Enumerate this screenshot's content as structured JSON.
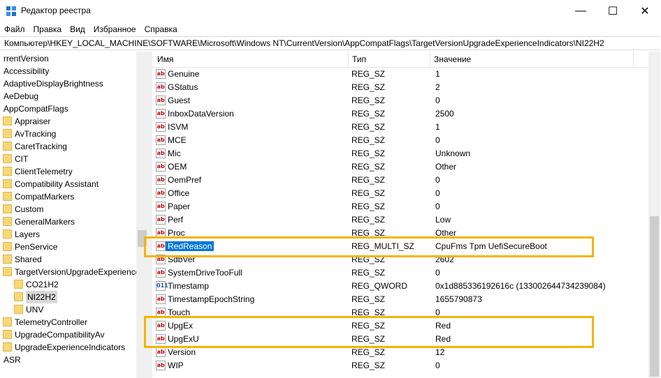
{
  "window": {
    "title": "Редактор реестра",
    "minimize_glyph": "—",
    "maximize_glyph": "☐",
    "close_glyph": "✕"
  },
  "menu": [
    "Файл",
    "Правка",
    "Вид",
    "Избранное",
    "Справка"
  ],
  "address": "Компьютер\\HKEY_LOCAL_MACHINE\\SOFTWARE\\Microsoft\\Windows NT\\CurrentVersion\\AppCompatFlags\\TargetVersionUpgradeExperienceIndicators\\NI22H2",
  "tree": [
    {
      "label": "rrentVersion",
      "folder": false,
      "level": 0
    },
    {
      "label": "Accessibility",
      "folder": false,
      "level": 0
    },
    {
      "label": "AdaptiveDisplayBrightness",
      "folder": false,
      "level": 0
    },
    {
      "label": "AeDebug",
      "folder": false,
      "level": 0
    },
    {
      "label": "AppCompatFlags",
      "folder": false,
      "level": 0
    },
    {
      "label": "Appraiser",
      "folder": true,
      "level": 1
    },
    {
      "label": "AvTracking",
      "folder": true,
      "level": 1
    },
    {
      "label": "CaretTracking",
      "folder": true,
      "level": 1
    },
    {
      "label": "CIT",
      "folder": true,
      "level": 1
    },
    {
      "label": "ClientTelemetry",
      "folder": true,
      "level": 1
    },
    {
      "label": "Compatibility Assistant",
      "folder": true,
      "level": 1
    },
    {
      "label": "CompatMarkers",
      "folder": true,
      "level": 1
    },
    {
      "label": "Custom",
      "folder": true,
      "level": 1
    },
    {
      "label": "GeneralMarkers",
      "folder": true,
      "level": 1
    },
    {
      "label": "Layers",
      "folder": true,
      "level": 1
    },
    {
      "label": "PenService",
      "folder": true,
      "level": 1
    },
    {
      "label": "Shared",
      "folder": true,
      "level": 1
    },
    {
      "label": "TargetVersionUpgradeExperience",
      "folder": true,
      "level": 1
    },
    {
      "label": "CO21H2",
      "folder": true,
      "level": 2
    },
    {
      "label": "NI22H2",
      "folder": true,
      "level": 2,
      "selected": true
    },
    {
      "label": "UNV",
      "folder": true,
      "level": 2
    },
    {
      "label": "TelemetryController",
      "folder": true,
      "level": 1
    },
    {
      "label": "UpgradeCompatibilityAv",
      "folder": true,
      "level": 1
    },
    {
      "label": "UpgradeExperienceIndicators",
      "folder": true,
      "level": 1
    },
    {
      "label": "ASR",
      "folder": false,
      "level": 0
    }
  ],
  "columns": {
    "name": "Имя",
    "type": "Тип",
    "value": "Значение"
  },
  "values": [
    {
      "name": "Genuine",
      "type": "REG_SZ",
      "value": "1",
      "icon": "ab"
    },
    {
      "name": "GStatus",
      "type": "REG_SZ",
      "value": "2",
      "icon": "ab"
    },
    {
      "name": "Guest",
      "type": "REG_SZ",
      "value": "0",
      "icon": "ab"
    },
    {
      "name": "InboxDataVersion",
      "type": "REG_SZ",
      "value": "2500",
      "icon": "ab"
    },
    {
      "name": "ISVM",
      "type": "REG_SZ",
      "value": "1",
      "icon": "ab"
    },
    {
      "name": "MCE",
      "type": "REG_SZ",
      "value": "0",
      "icon": "ab"
    },
    {
      "name": "Mic",
      "type": "REG_SZ",
      "value": "Unknown",
      "icon": "ab"
    },
    {
      "name": "OEM",
      "type": "REG_SZ",
      "value": "Other",
      "icon": "ab"
    },
    {
      "name": "OemPref",
      "type": "REG_SZ",
      "value": "0",
      "icon": "ab"
    },
    {
      "name": "Office",
      "type": "REG_SZ",
      "value": "0",
      "icon": "ab"
    },
    {
      "name": "Paper",
      "type": "REG_SZ",
      "value": "0",
      "icon": "ab"
    },
    {
      "name": "Perf",
      "type": "REG_SZ",
      "value": "Low",
      "icon": "ab"
    },
    {
      "name": "Proc",
      "type": "REG_SZ",
      "value": "Other",
      "icon": "ab"
    },
    {
      "name": "RedReason",
      "type": "REG_MULTI_SZ",
      "value": "CpuFms Tpm UefiSecureBoot",
      "icon": "ab",
      "selected": true
    },
    {
      "name": "SdbVer",
      "type": "REG_SZ",
      "value": "2602",
      "icon": "ab"
    },
    {
      "name": "SystemDriveTooFull",
      "type": "REG_SZ",
      "value": "0",
      "icon": "ab"
    },
    {
      "name": "Timestamp",
      "type": "REG_QWORD",
      "value": "0x1d885336192616c (133002644734239084)",
      "icon": "bin"
    },
    {
      "name": "TimestampEpochString",
      "type": "REG_SZ",
      "value": "1655790873",
      "icon": "ab"
    },
    {
      "name": "Touch",
      "type": "REG_SZ",
      "value": "0",
      "icon": "ab"
    },
    {
      "name": "UpgEx",
      "type": "REG_SZ",
      "value": "Red",
      "icon": "ab"
    },
    {
      "name": "UpgExU",
      "type": "REG_SZ",
      "value": "Red",
      "icon": "ab"
    },
    {
      "name": "Version",
      "type": "REG_SZ",
      "value": "12",
      "icon": "ab"
    },
    {
      "name": "WIP",
      "type": "REG_SZ",
      "value": "0",
      "icon": "ab"
    }
  ],
  "colors": {
    "highlight": "#f4b400",
    "selection": "#0078d7",
    "folder": "#f8d775"
  }
}
